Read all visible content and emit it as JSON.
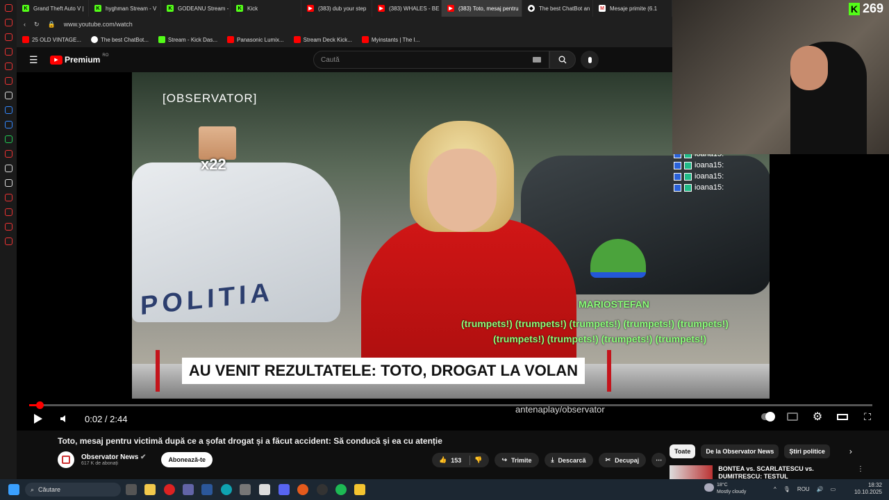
{
  "browser": {
    "tabs": [
      {
        "label": "Grand Theft Auto V |",
        "icon": "kick-icon"
      },
      {
        "label": "hyghman Stream - V",
        "icon": "kick-icon"
      },
      {
        "label": "GODEANU Stream -",
        "icon": "kick-icon"
      },
      {
        "label": "Kick",
        "icon": "kick-icon"
      },
      {
        "label": "(383) dub your step",
        "icon": "youtube-icon"
      },
      {
        "label": "(383) WHALES - BE",
        "icon": "youtube-icon"
      },
      {
        "label": "(383) Toto, mesaj pentru",
        "icon": "youtube-icon",
        "active": true
      },
      {
        "label": "The best ChatBot an",
        "icon": "chatbot-icon"
      },
      {
        "label": "Mesaje primite (6.1",
        "icon": "gmail-icon"
      }
    ],
    "url": "www.youtube.com/watch",
    "bookmarks": [
      {
        "label": "25 OLD VINTAGE..."
      },
      {
        "label": "The best ChatBot..."
      },
      {
        "label": "Stream - Kick Das..."
      },
      {
        "label": "Panasonic Lumix..."
      },
      {
        "label": "Stream Deck Kick..."
      },
      {
        "label": "Myinstants | The I..."
      }
    ]
  },
  "youtube": {
    "logo": "Premium",
    "logo_region": "RO",
    "search_placeholder": "Caută"
  },
  "video": {
    "channel_watermark": "[OBSERVATOR]",
    "headline": "AU VENIT REZULTATELE: TOTO, DROGAT LA VOLAN",
    "scene_text": "POLITIA",
    "corner_watermark": "antenaplay/observator",
    "time_current": "0:02",
    "time_total": "2:44",
    "progress": 0.012
  },
  "overlay": {
    "emote_count": "x22",
    "chat_user": "MARIOSTEFAN",
    "chat_line_1": "(trumpets!) (trumpets!) (trumpets!) (trumpets!) (trumpets!)",
    "chat_line_2": "(trumpets!) (trumpets!) (trumpets!) (trumpets!)",
    "side_chat": [
      "ioana15:",
      "ioana15:",
      "ioana15:",
      "ioana15:"
    ],
    "viewer_count": "269"
  },
  "meta": {
    "title": "Toto, mesaj pentru victimă după ce a șofat drogat și a făcut accident: Să conducă și ea cu atenție",
    "channel_name": "Observator News",
    "subscribers": "617 K de abonați",
    "subscribe_label": "Abonează-te",
    "likes": "153",
    "share_label": "Trimite",
    "download_label": "Descarcă",
    "clip_label": "Decupaj"
  },
  "chips": [
    "Toate",
    "De la Observator News",
    "Știri politice"
  ],
  "recommendation": {
    "title": "BONTEA vs. SCARLATESCU vs. DUMITRESCU: TESTUL"
  },
  "taskbar": {
    "search_label": "Căutare",
    "weather_temp": "18°C",
    "weather_desc": "Mostly cloudy",
    "lang": "ROU",
    "time": "18:32",
    "date": "10.10.2025"
  },
  "colors": {
    "yt_red": "#ff0000",
    "kick_green": "#53fc18",
    "chat_green": "#8bff7a",
    "lower_third_red": "#c4141b"
  }
}
